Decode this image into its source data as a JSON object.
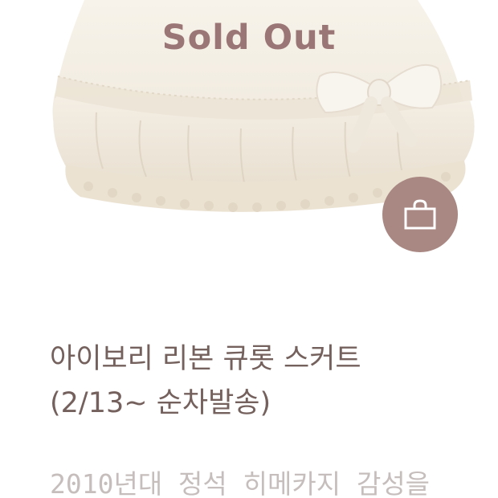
{
  "product": {
    "status_overlay": "Sold Out",
    "title_line1": "아이보리 리본 큐롯 스커트",
    "title_line2": "(2/13~ 순차발송)",
    "description": "2010년대 정석 히메카지 감성을"
  },
  "cart_button": {
    "icon": "shopping-bag-icon"
  },
  "colors": {
    "sold_out_text": "#9b7676",
    "cart_button_bg": "#a98782",
    "title_text": "#74605c",
    "description_text": "#c6bebd"
  }
}
